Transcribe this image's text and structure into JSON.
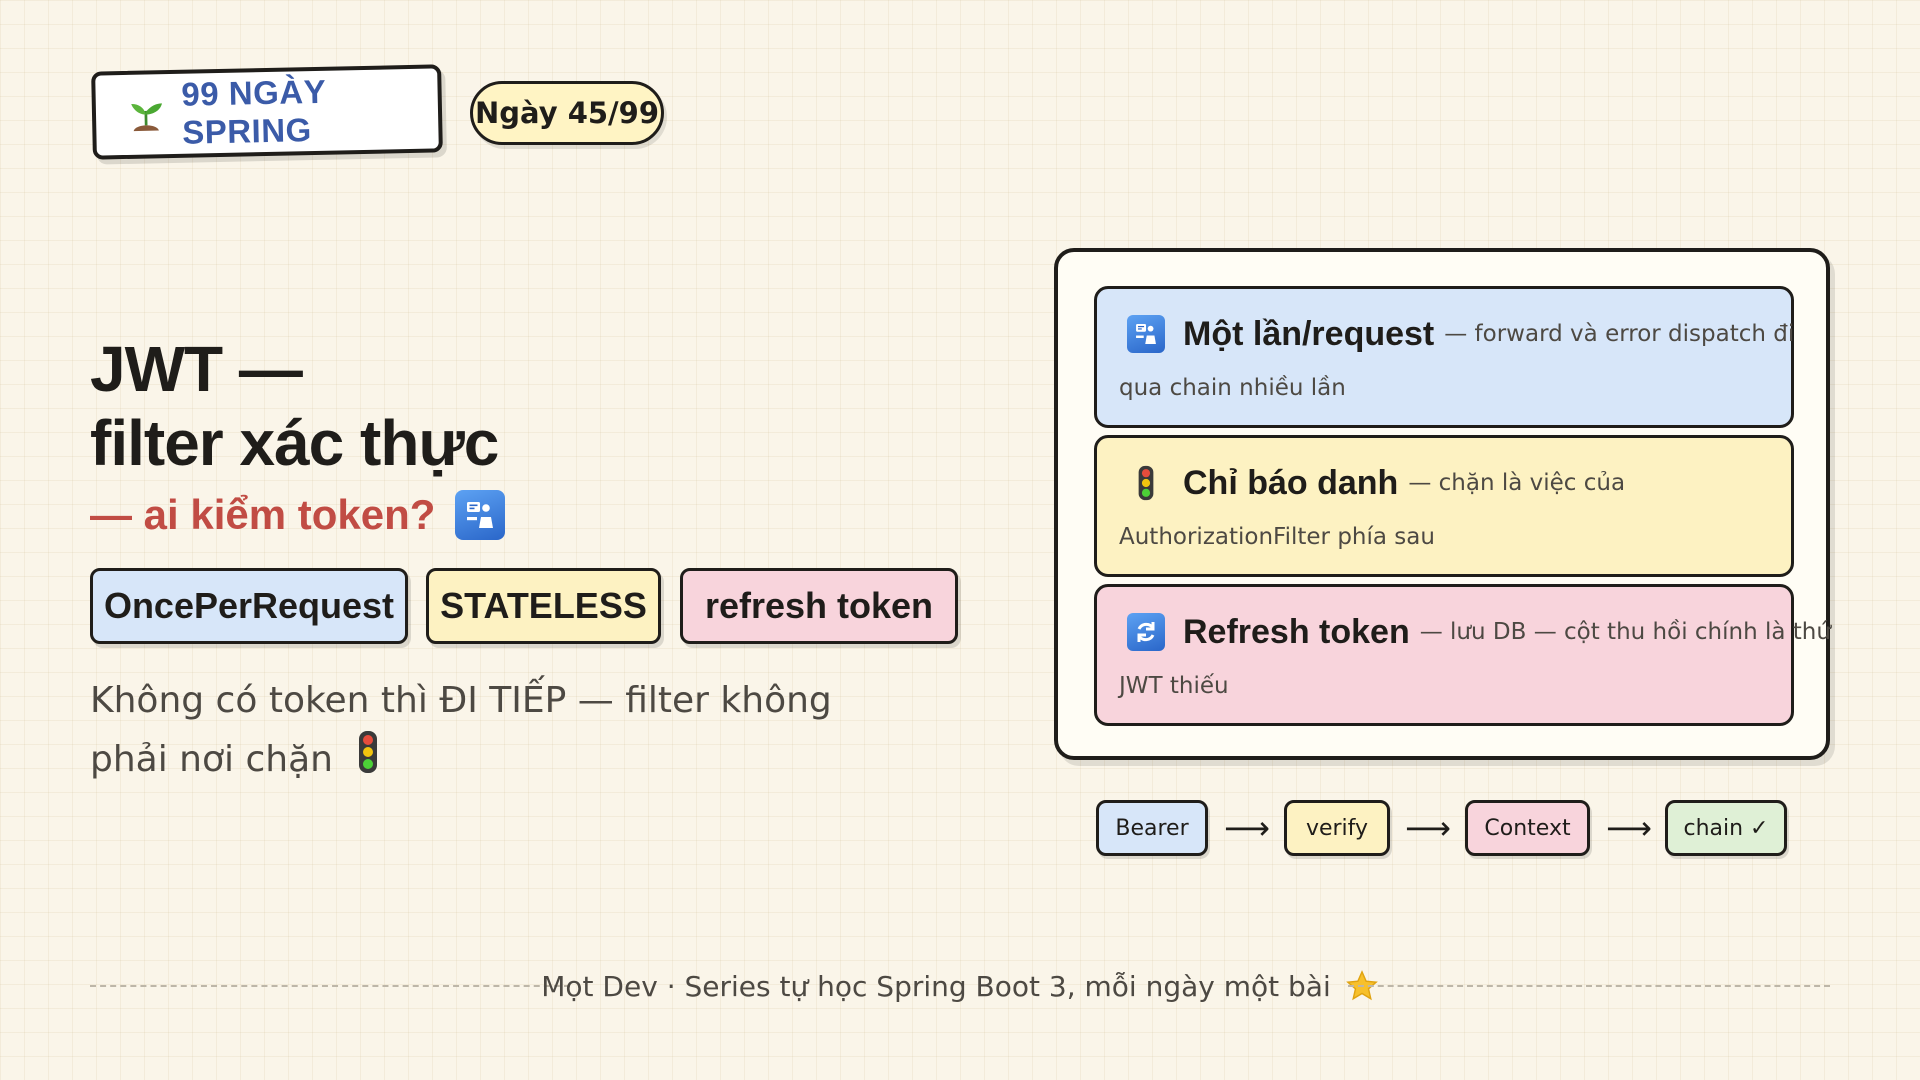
{
  "header": {
    "brand": "99 NGÀY SPRING",
    "day_badge": "Ngày 45/99"
  },
  "title": {
    "line1": "JWT —",
    "line2": "filter xác thực",
    "subtitle": "— ai kiểm token?"
  },
  "tags": [
    "OncePerRequest",
    "STATELESS",
    "refresh token"
  ],
  "description": "Không có token thì ĐI TIẾP — filter không phải nơi chặn",
  "cards": [
    {
      "icon": "passport-control-icon",
      "title": "Một lần/request",
      "desc_inline": "— forward và error dispatch đi",
      "desc_line2": "qua chain nhiều lần"
    },
    {
      "icon": "traffic-light-icon",
      "title": "Chỉ báo danh",
      "desc_inline": "— chặn là việc của",
      "desc_line2": "AuthorizationFilter phía sau"
    },
    {
      "icon": "refresh-icon",
      "title": "Refresh token",
      "desc_inline": "— lưu DB — cột thu hồi chính là thứ",
      "desc_line2": "JWT thiếu"
    }
  ],
  "flow": {
    "steps": [
      "Bearer",
      "verify",
      "Context",
      "chain ✓"
    ],
    "arrow": "⟶"
  },
  "footer": {
    "text": "Mọt Dev · Series tự học Spring Boot 3, mỗi ngày một bài"
  },
  "colors": {
    "background": "#faf5e9",
    "blue": "#d7e6f9",
    "yellow": "#fdf2c2",
    "pink": "#f8d4dc",
    "green": "#dff0d6",
    "accent_red": "#c14c44",
    "brand_blue": "#3b5ba8",
    "ink": "#1f1d1a"
  }
}
